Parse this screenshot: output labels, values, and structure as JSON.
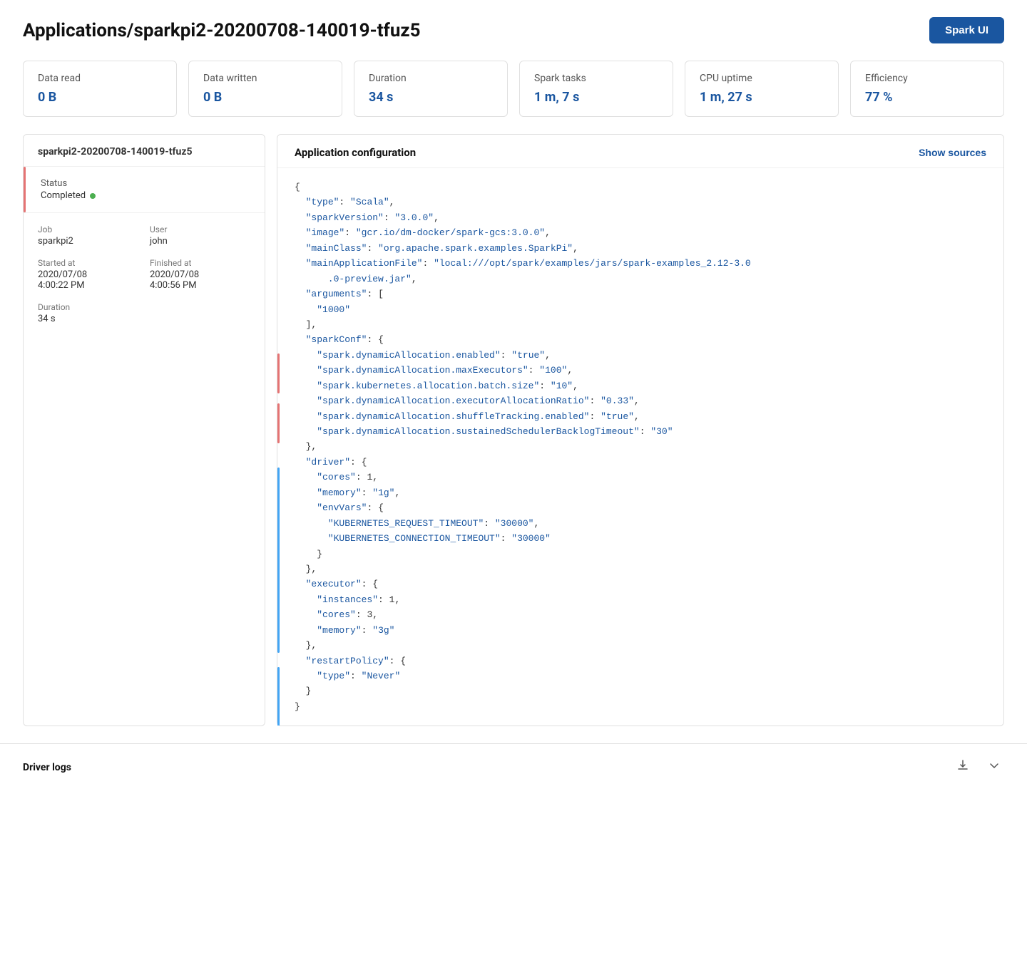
{
  "header": {
    "title": "Applications/sparkpi2-20200708-140019-tfuz5",
    "spark_ui_btn": "Spark UI"
  },
  "metrics": [
    {
      "label": "Data read",
      "value": "0 B"
    },
    {
      "label": "Data written",
      "value": "0 B"
    },
    {
      "label": "Duration",
      "value": "34 s"
    },
    {
      "label": "Spark tasks",
      "value": "1 m, 7 s"
    },
    {
      "label": "CPU uptime",
      "value": "1 m, 27 s"
    },
    {
      "label": "Efficiency",
      "value": "77 %"
    }
  ],
  "left_panel": {
    "title": "sparkpi2-20200708-140019-tfuz5",
    "status_label": "Status",
    "status_value": "Completed",
    "job_label": "Job",
    "job_value": "sparkpi2",
    "user_label": "User",
    "user_value": "john",
    "started_label": "Started at",
    "started_date": "2020/07/08",
    "started_time": "4:00:22 PM",
    "finished_label": "Finished at",
    "finished_date": "2020/07/08",
    "finished_time": "4:00:56 PM",
    "duration_label": "Duration",
    "duration_value": "34 s"
  },
  "right_panel": {
    "title": "Application configuration",
    "show_sources": "Show sources"
  },
  "driver_logs": {
    "title": "Driver logs"
  }
}
